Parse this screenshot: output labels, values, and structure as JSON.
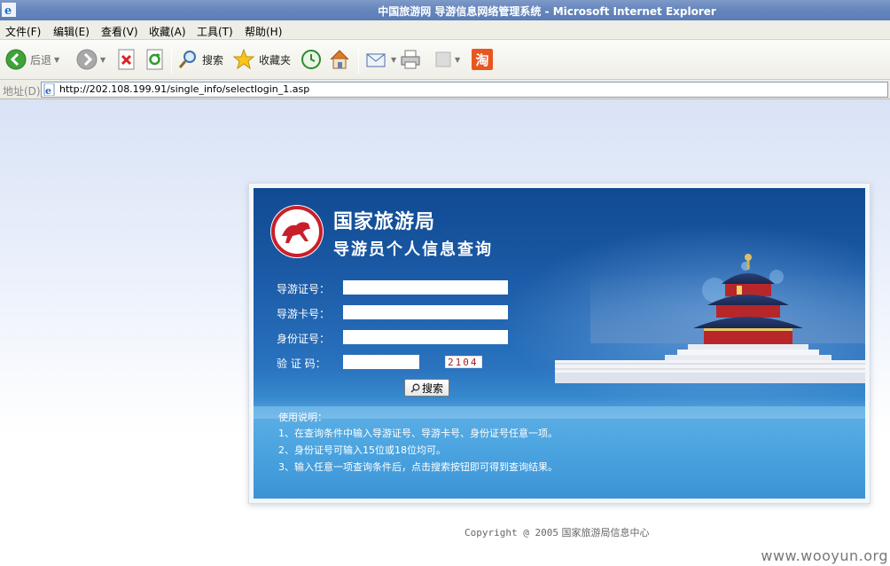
{
  "window": {
    "title": "中国旅游网 导游信息网络管理系统 - Microsoft Internet Explorer"
  },
  "menu": {
    "items": [
      "文件(F)",
      "编辑(E)",
      "查看(V)",
      "收藏(A)",
      "工具(T)",
      "帮助(H)"
    ]
  },
  "toolbar": {
    "back_label": "后退",
    "search_label": "搜索",
    "favorites_label": "收藏夹",
    "taobao_glyph": "淘"
  },
  "address": {
    "label": "地址(D)",
    "url": "http://202.108.199.91/single_info/selectlogin_1.asp"
  },
  "page": {
    "heading_main": "国家旅游局",
    "heading_sub": "导游员个人信息查询",
    "fields": {
      "guide_cert_label": "导游证号：",
      "guide_cert_value": "",
      "guide_card_label": "导游卡号：",
      "guide_card_value": "",
      "id_label": "身份证号：",
      "id_value": "",
      "captcha_label": "验 证 码：",
      "captcha_value": "",
      "captcha_code": "2104"
    },
    "search_button": "搜索",
    "instructions": {
      "title": "使用说明：",
      "lines": [
        "1、在查询条件中输入导游证号、导游卡号、身份证号任意一项。",
        "2、身份证号可输入15位或18位均可。",
        "3、输入任意一项查询条件后，点击搜索按钮即可得到查询结果。"
      ]
    },
    "footer": {
      "copyright": "Copyright @ 2005",
      "org": "国家旅游局信息中心"
    }
  },
  "watermark": "www.wooyun.org",
  "colors": {
    "titlebar": "#6686bd",
    "panel_top": "#104a92",
    "panel_bottom": "#4aa4e0",
    "captcha": "#a02020"
  }
}
